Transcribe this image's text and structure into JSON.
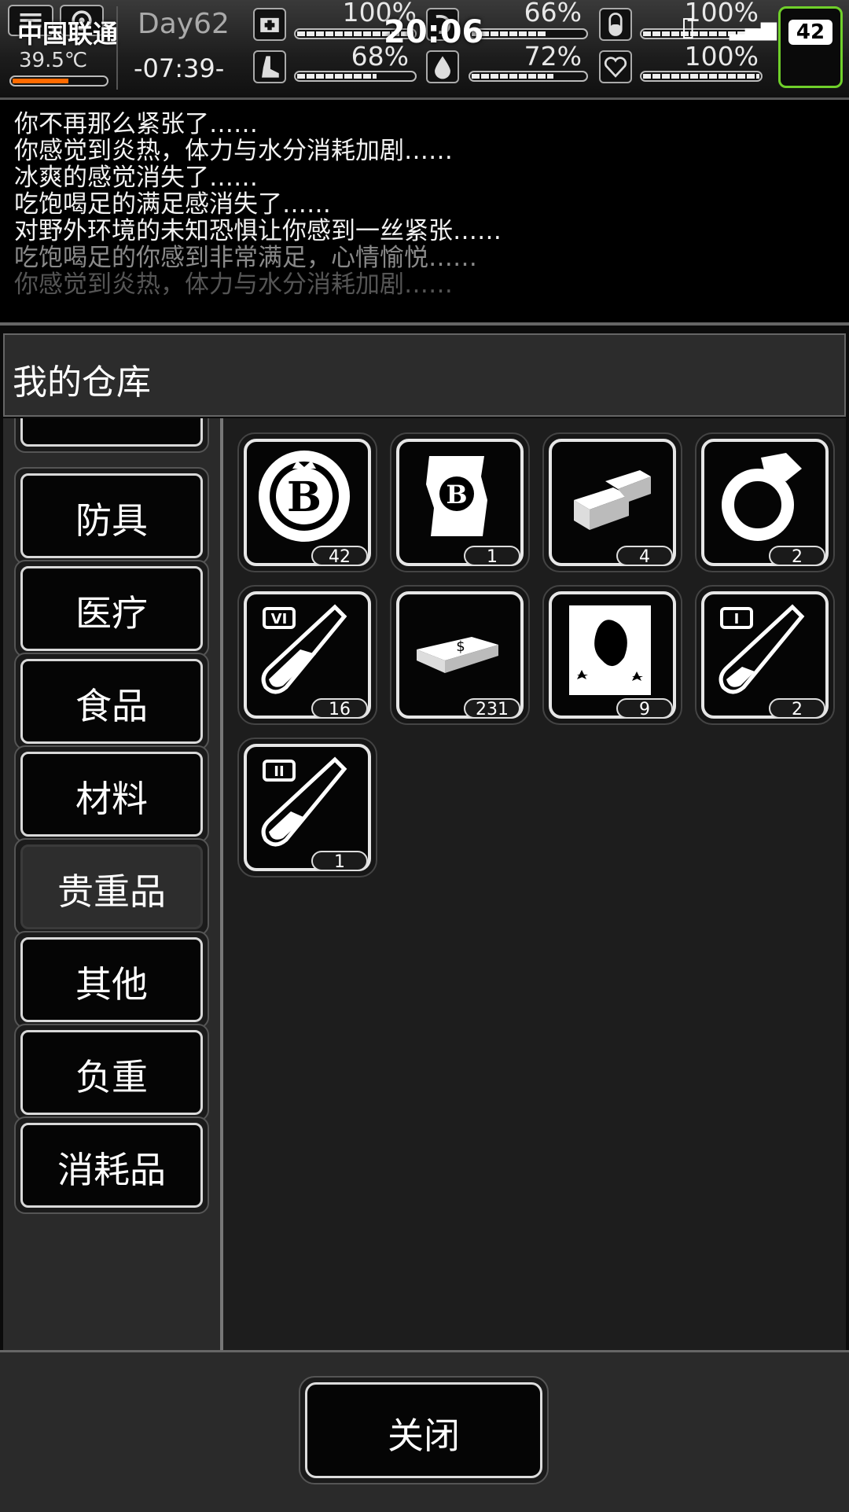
{
  "status_bar": {
    "carrier": "中国联通",
    "time": "20:06",
    "battery": "42"
  },
  "hud": {
    "day": "Day62",
    "clock": "-07:39-",
    "temperature": "39.5℃",
    "temperature_level": 0.6,
    "stats": [
      {
        "name": "health",
        "icon": "first-aid-icon",
        "value": "100%",
        "level": 1.0
      },
      {
        "name": "hunger",
        "icon": "stomach-icon",
        "value": "66%",
        "level": 0.66
      },
      {
        "name": "pill",
        "icon": "pill-icon",
        "value": "100%",
        "level": 1.0
      },
      {
        "name": "stamina",
        "icon": "foot-icon",
        "value": "68%",
        "level": 0.68
      },
      {
        "name": "water",
        "icon": "water-drop-icon",
        "value": "72%",
        "level": 0.72
      },
      {
        "name": "mood",
        "icon": "heart-icon",
        "value": "100%",
        "level": 1.0
      }
    ]
  },
  "log": [
    "你不再那么紧张了……",
    "你感觉到炎热，体力与水分消耗加剧……",
    "冰爽的感觉消失了……",
    "吃饱喝足的满足感消失了……",
    "对野外环境的未知恐惧让你感到一丝紧张……",
    "吃饱喝足的你感到非常满足，心情愉悦……",
    "你感觉到炎热，体力与水分消耗加剧……"
  ],
  "warehouse": {
    "title": "我的仓库",
    "categories": [
      "防具",
      "医疗",
      "食品",
      "材料",
      "贵重品",
      "其他",
      "负重",
      "消耗品"
    ],
    "active_category": "贵重品",
    "items": [
      {
        "icon": "casino-chip-icon",
        "count": "42"
      },
      {
        "icon": "bitcoin-note-icon",
        "count": "1"
      },
      {
        "icon": "gold-bars-icon",
        "count": "4"
      },
      {
        "icon": "diamond-ring-icon",
        "count": "2"
      },
      {
        "icon": "test-tube-vi-icon",
        "count": "16"
      },
      {
        "icon": "cash-stack-icon",
        "count": "231"
      },
      {
        "icon": "zombie-card-icon",
        "count": "9"
      },
      {
        "icon": "test-tube-i-icon",
        "count": "2"
      },
      {
        "icon": "test-tube-ii-icon",
        "count": "1"
      }
    ]
  },
  "footer": {
    "close_label": "关闭"
  },
  "colors": {
    "accent_green": "#6fcf2a",
    "temperature_orange": "#ff6a00"
  }
}
